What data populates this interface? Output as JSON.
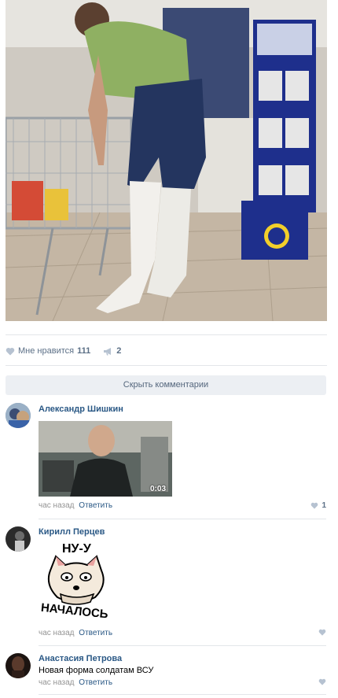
{
  "post": {
    "actions": {
      "like_label": "Мне нравится",
      "like_count": "111",
      "share_count": "2"
    },
    "hide_comments_label": "Скрыть комментарии"
  },
  "colors": {
    "link": "#2a5885",
    "icon": "#b6c2d1",
    "button_bg": "#eceff3"
  },
  "comments": [
    {
      "author": "Александр Шишкин",
      "attachment": "video",
      "video_duration": "0:03",
      "time": "час назад",
      "reply_label": "Ответить",
      "likes": "1"
    },
    {
      "author": "Кирилл Перцев",
      "attachment": "sticker",
      "sticker_text_top": "НУ-У",
      "sticker_text_bottom": "НАЧАЛОСЬ",
      "time": "час назад",
      "reply_label": "Ответить"
    },
    {
      "author": "Анастасия Петрова",
      "text": "Новая форма солдатам ВСУ",
      "time": "час назад",
      "reply_label": "Ответить"
    }
  ]
}
